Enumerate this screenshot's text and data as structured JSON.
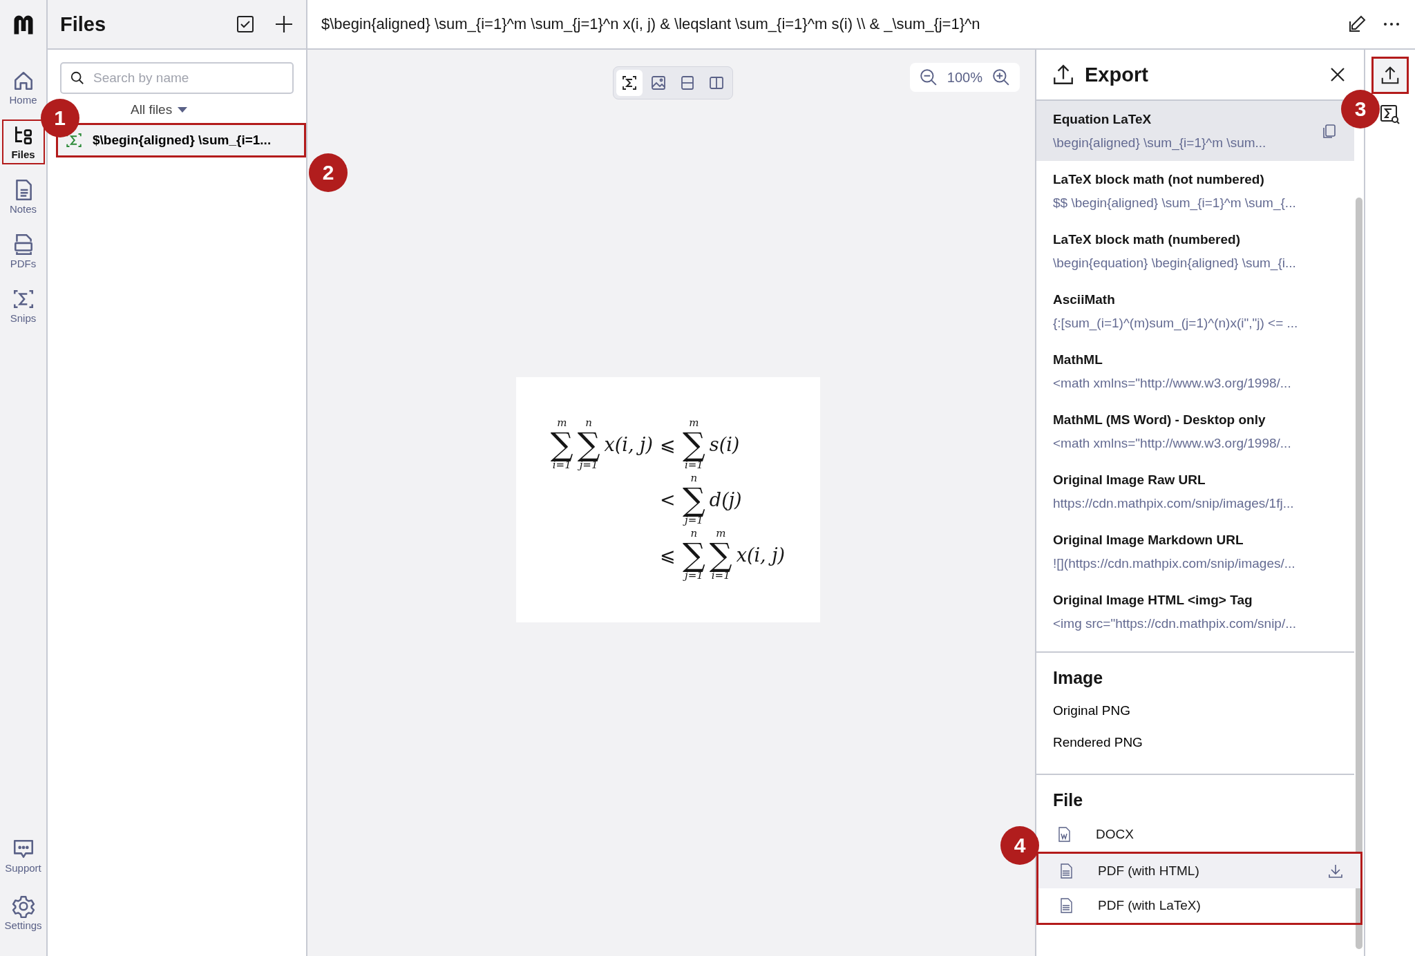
{
  "nav": {
    "items": [
      {
        "label": "Home",
        "kind": "home",
        "selected": false,
        "marker": ""
      },
      {
        "label": "Files",
        "kind": "files",
        "selected": true,
        "marker": "1"
      },
      {
        "label": "Notes",
        "kind": "notes",
        "selected": false,
        "marker": ""
      },
      {
        "label": "PDFs",
        "kind": "pdfs",
        "selected": false,
        "marker": ""
      },
      {
        "label": "Snips",
        "kind": "snips",
        "selected": false,
        "marker": ""
      }
    ],
    "bottom_items": [
      {
        "label": "Support",
        "kind": "support"
      },
      {
        "label": "Settings",
        "kind": "settings"
      }
    ]
  },
  "files_panel": {
    "title": "Files",
    "search": {
      "placeholder": "Search by name"
    },
    "filter": "All files",
    "files": [
      {
        "name": "$\\begin{aligned} \\sum_{i=1...",
        "selected": true,
        "marker": "2"
      }
    ]
  },
  "title_bar": {
    "title": "$\\begin{aligned} \\sum_{i=1}^m \\sum_{j=1}^n x(i, j) & \\leqslant \\sum_{i=1}^m s(i) \\\\ & _\\sum_{j=1}^n"
  },
  "view_modes": [
    {
      "kind": "formula",
      "selected": true
    },
    {
      "kind": "image",
      "selected": false
    },
    {
      "kind": "split-horizontal",
      "selected": false
    },
    {
      "kind": "split-vertical",
      "selected": false
    }
  ],
  "zoom": {
    "value": "100%"
  },
  "equation": {
    "rows": [
      {
        "left": [
          {
            "kind": "sum",
            "symbol": "∑",
            "upper": "m",
            "lower": "i=1"
          },
          {
            "kind": "sum",
            "symbol": "∑",
            "upper": "n",
            "lower": "j=1"
          },
          {
            "kind": "expr",
            "text": "x(i, j)"
          }
        ],
        "relation": "⩽",
        "right": [
          {
            "kind": "sum",
            "symbol": "∑",
            "upper": "m",
            "lower": "i=1"
          },
          {
            "kind": "expr",
            "text": "s(i)"
          }
        ]
      },
      {
        "left": [],
        "relation": "<",
        "right": [
          {
            "kind": "sum",
            "symbol": "∑",
            "upper": "n",
            "lower": "j=1"
          },
          {
            "kind": "expr",
            "text": "d(j)"
          }
        ]
      },
      {
        "left": [],
        "relation": "⩽",
        "right": [
          {
            "kind": "sum",
            "symbol": "∑",
            "upper": "n",
            "lower": "j=1"
          },
          {
            "kind": "sum",
            "symbol": "∑",
            "upper": "m",
            "lower": "i=1"
          },
          {
            "kind": "expr",
            "text": "x(i, j)"
          }
        ]
      }
    ]
  },
  "export_panel": {
    "title": "Export",
    "formats": [
      {
        "title": "Equation LaTeX",
        "preview": "\\begin{aligned} \\sum_{i=1}^m \\sum...",
        "selected": true
      },
      {
        "title": "LaTeX block math (not numbered)",
        "preview": "$$ \\begin{aligned} \\sum_{i=1}^m \\sum_{...",
        "selected": false
      },
      {
        "title": "LaTeX block math (numbered)",
        "preview": "\\begin{equation} \\begin{aligned} \\sum_{i...",
        "selected": false
      },
      {
        "title": "AsciiMath",
        "preview": "{:[sum_(i=1)^(m)sum_(j=1)^(n)x(i\",\"j) <= ...",
        "selected": false
      },
      {
        "title": "MathML",
        "preview": "<math xmlns=\"http://www.w3.org/1998/...",
        "selected": false
      },
      {
        "title": "MathML (MS Word) - Desktop only",
        "preview": "<math xmlns=\"http://www.w3.org/1998/...",
        "selected": false
      },
      {
        "title": "Original Image Raw URL",
        "preview": "https://cdn.mathpix.com/snip/images/1fj...",
        "selected": false
      },
      {
        "title": "Original Image Markdown URL",
        "preview": "![](https://cdn.mathpix.com/snip/images/...",
        "selected": false
      },
      {
        "title": "Original Image HTML <img> Tag",
        "preview": "<img src=\"https://cdn.mathpix.com/snip/...",
        "selected": false
      }
    ],
    "image_section": {
      "heading": "Image",
      "items": [
        "Original PNG",
        "Rendered PNG"
      ]
    },
    "file_section": {
      "heading": "File",
      "marker": "4",
      "items": [
        {
          "label": "DOCX",
          "kind": "word",
          "hovered": false,
          "highlighted": false
        },
        {
          "label": "PDF (with HTML)",
          "kind": "pdf",
          "hovered": true,
          "highlighted": true
        },
        {
          "label": "PDF (with LaTeX)",
          "kind": "pdf",
          "hovered": false,
          "highlighted": true
        }
      ]
    }
  },
  "right_rail": {
    "export_button": {
      "selected": true,
      "marker": "3"
    }
  }
}
